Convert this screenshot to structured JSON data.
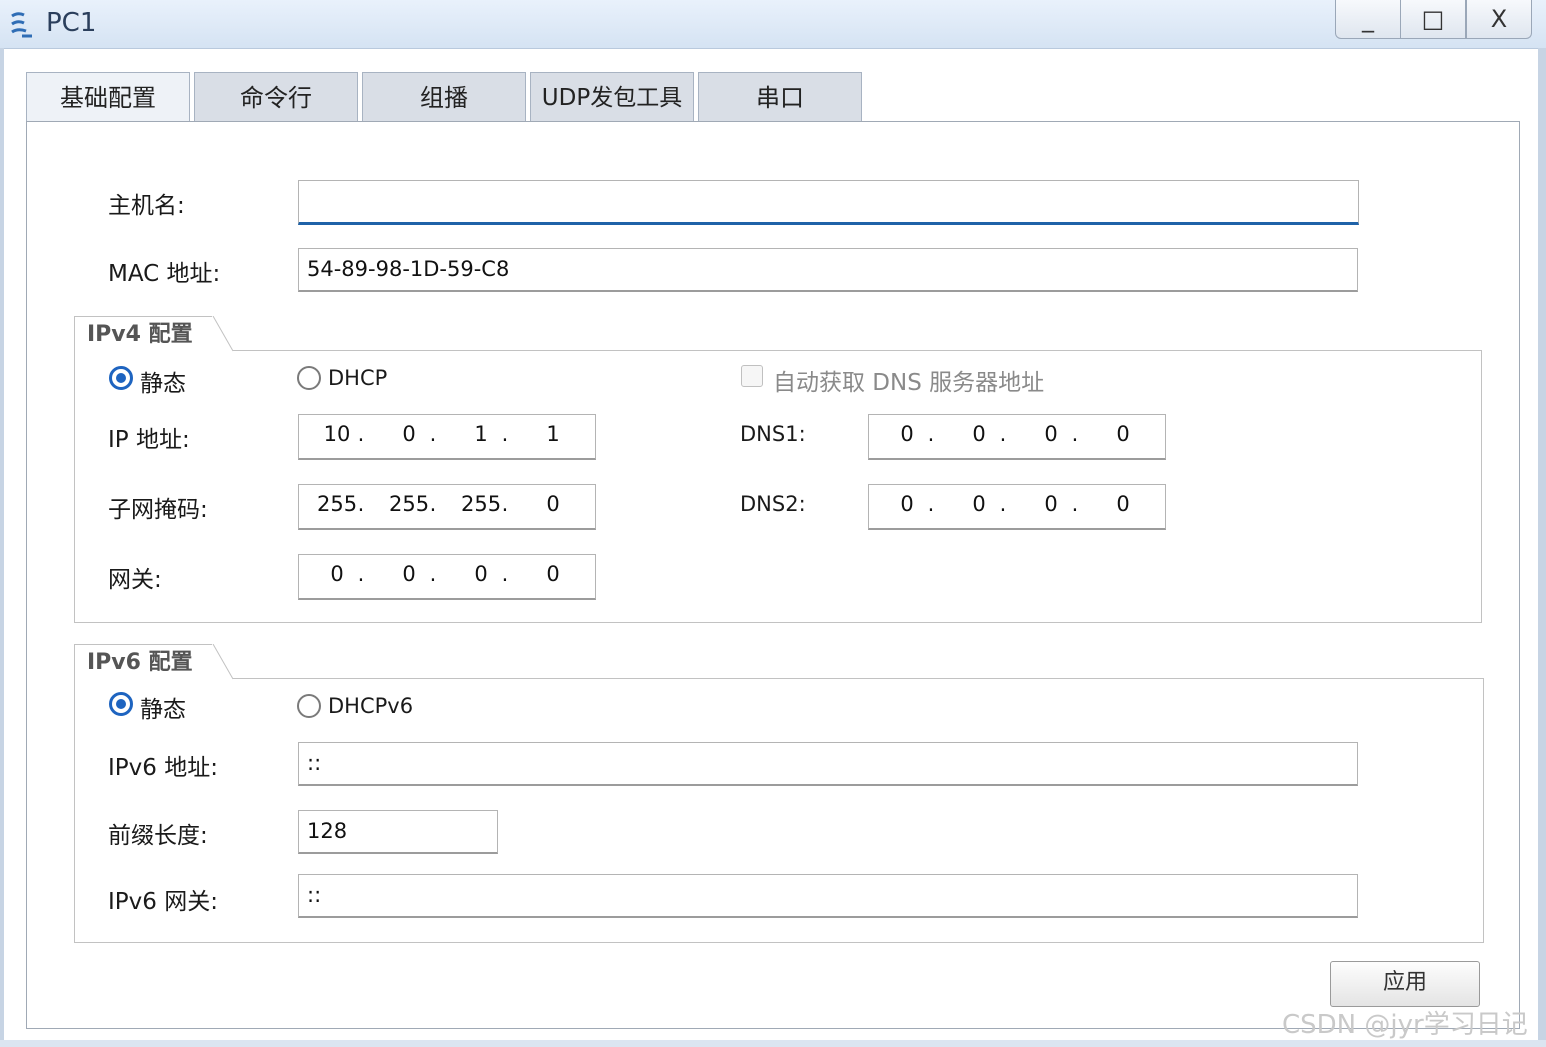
{
  "window": {
    "title": "PC1",
    "minimize_label": "_",
    "maximize_label": "□",
    "close_label": "X"
  },
  "tabs": [
    {
      "label": "基础配置",
      "active": true
    },
    {
      "label": "命令行",
      "active": false
    },
    {
      "label": "组播",
      "active": false
    },
    {
      "label": "UDP发包工具",
      "active": false
    },
    {
      "label": "串口",
      "active": false
    }
  ],
  "basic": {
    "hostname_label": "主机名:",
    "hostname_value": "",
    "mac_label": "MAC 地址:",
    "mac_value": "54-89-98-1D-59-C8"
  },
  "ipv4": {
    "group_title": "IPv4 配置",
    "static_label": "静态",
    "dhcp_label": "DHCP",
    "mode": "static",
    "auto_dns_label": "自动获取 DNS 服务器地址",
    "auto_dns_checked": false,
    "ip_label": "IP 地址:",
    "ip": [
      "10",
      "0",
      "1",
      "1"
    ],
    "mask_label": "子网掩码:",
    "mask": [
      "255",
      "255",
      "255",
      "0"
    ],
    "gateway_label": "网关:",
    "gateway": [
      "0",
      "0",
      "0",
      "0"
    ],
    "dns1_label": "DNS1:",
    "dns1": [
      "0",
      "0",
      "0",
      "0"
    ],
    "dns2_label": "DNS2:",
    "dns2": [
      "0",
      "0",
      "0",
      "0"
    ],
    "dot": "."
  },
  "ipv6": {
    "group_title": "IPv6 配置",
    "static_label": "静态",
    "dhcp_label": "DHCPv6",
    "mode": "static",
    "address_label": "IPv6 地址:",
    "address_value": "::",
    "prefix_label": "前缀长度:",
    "prefix_value": "128",
    "gateway_label": "IPv6 网关:",
    "gateway_value": "::"
  },
  "apply_label": "应用",
  "watermark": "CSDN @jyr学习日记",
  "colors": {
    "accent": "#1e64c0",
    "titlebar": "#d5e3f3",
    "focus_underline": "#1f62a8"
  },
  "icons": {
    "app": "network-pc-icon"
  }
}
